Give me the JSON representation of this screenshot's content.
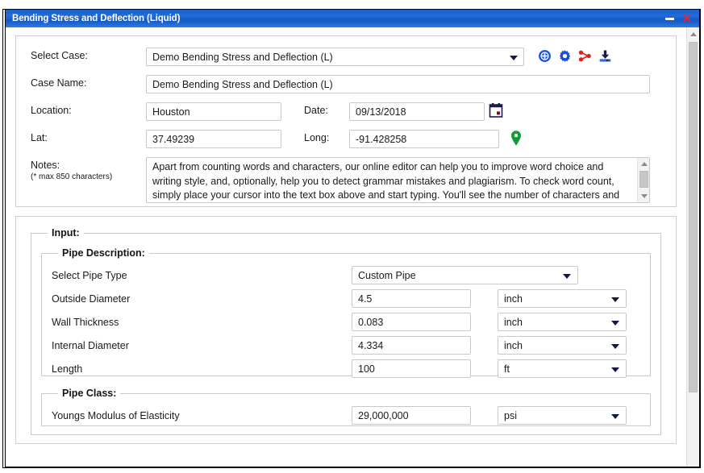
{
  "window": {
    "title": "Bending Stress and Deflection (Liquid)",
    "minimize_label": "–",
    "close_label": "✕",
    "title_bar_color": "#1f6ddc",
    "close_color": "#f0222a"
  },
  "case": {
    "select_case_label": "Select Case:",
    "select_case_value": "Demo Bending Stress and Deflection (L)",
    "case_name_label": "Case Name:",
    "case_name_value": "Demo Bending Stress and Deflection (L)",
    "location_label": "Location:",
    "location_value": "Houston",
    "date_label": "Date:",
    "date_value": "09/13/2018",
    "lat_label": "Lat:",
    "lat_value": "37.49239",
    "long_label": "Long:",
    "long_value": "-91.428258",
    "notes_label": "Notes:",
    "notes_sublabel": "(* max 850 characters)",
    "notes_value": "Apart from counting words and characters, our online editor can help you to improve word choice and writing style, and, optionally, help you to detect grammar mistakes and plagiarism. To check word count, simply place your cursor into the text box above and start typing. You'll see the number of characters and",
    "icons": {
      "add": "add-circle-icon",
      "settings": "gear-icon",
      "share": "share-icon",
      "download": "download-icon",
      "date_picker": "calendar-icon",
      "map_pin": "map-pin-icon"
    },
    "icon_colors": {
      "add": "#1a4fd6",
      "gear": "#1a4fd6",
      "share": "#e02020",
      "download": "#1a4fd6",
      "calendar": "#1b1b4f",
      "map_pin": "#0f9b35"
    }
  },
  "input": {
    "legend": "Input:",
    "pipe_description": {
      "legend": "Pipe Description:",
      "pipe_type_label": "Select Pipe Type",
      "pipe_type_value": "Custom Pipe",
      "rows": [
        {
          "label": "Outside Diameter",
          "value": "4.5",
          "unit": "inch"
        },
        {
          "label": "Wall Thickness",
          "value": "0.083",
          "unit": "inch"
        },
        {
          "label": "Internal Diameter",
          "value": "4.334",
          "unit": "inch"
        },
        {
          "label": "Length",
          "value": "100",
          "unit": "ft"
        }
      ]
    },
    "pipe_class": {
      "legend": "Pipe Class:",
      "rows": [
        {
          "label": "Youngs Modulus of Elasticity",
          "value": "29,000,000",
          "unit": "psi"
        }
      ]
    }
  },
  "scrollbars": {
    "up_arrow": "scroll-up-arrow-icon",
    "down_arrow": "scroll-down-arrow-icon"
  }
}
